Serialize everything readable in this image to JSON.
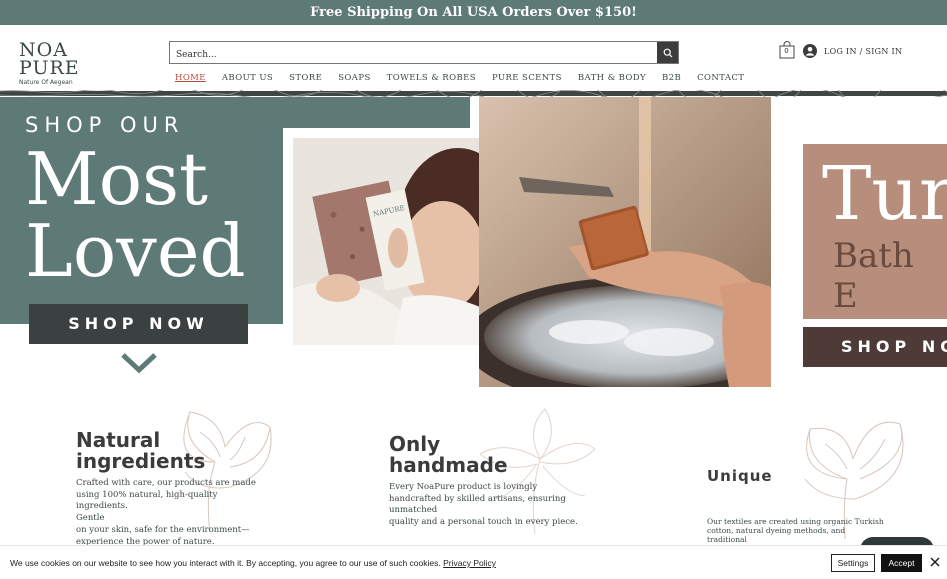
{
  "promo": {
    "text": "Free Shipping On All USA Orders Over $150!"
  },
  "logo": {
    "line1": "NOA",
    "line2": "PURE",
    "tagline": "Nature Of Aegean"
  },
  "search": {
    "placeholder": "Search..."
  },
  "cart": {
    "count": "0"
  },
  "account": {
    "label": "LOG IN / SIGN IN"
  },
  "nav": {
    "items": [
      {
        "label": "HOME"
      },
      {
        "label": "ABOUT US"
      },
      {
        "label": "STORE"
      },
      {
        "label": "SOAPS"
      },
      {
        "label": "TOWELS & ROBES"
      },
      {
        "label": "PURE SCENTS"
      },
      {
        "label": "BATH & BODY"
      },
      {
        "label": "B2B"
      },
      {
        "label": "CONTACT"
      }
    ],
    "active": "HOME"
  },
  "hero": {
    "kicker": "SHOP OUR",
    "headline_1": "Most",
    "headline_2": "Loved",
    "cta": "SHOP NOW",
    "photo1_wrapper_text": "NAPURE"
  },
  "next_slide": {
    "title": "Tur",
    "subtitle": "Bath E",
    "cta": "SHOP NO"
  },
  "features": [
    {
      "title_1": "Natural",
      "title_2": "ingredients",
      "text_1": "Crafted with care, our products are made",
      "text_2": "using 100% natural, high-quality ingredients.",
      "text_3": "Gentle",
      "text_4": "on your skin, safe for the environment—",
      "text_5": "experience the power of nature."
    },
    {
      "title_1": "Only",
      "title_2": "handmade",
      "text_1": "Every NoaPure product is lovingly",
      "text_2": "handcrafted by skilled artisans, ensuring",
      "text_3": "unmatched",
      "text_4": "quality and a personal touch in every piece."
    },
    {
      "title_1": "Unique",
      "text_1": "Our textiles are created using organic Turkish",
      "text_2": "cotton, natural dyeing methods, and",
      "text_3": "traditional"
    }
  ],
  "cookie": {
    "text": "We use cookies on our website to see how you interact with it. By accepting, you agree to our use of such cookies.",
    "link": "Privacy Policy",
    "settings": "Settings",
    "accept": "Accept"
  },
  "colors": {
    "sage": "#5e7a76",
    "charcoal": "#3b4040",
    "accent_nav": "#b5493a",
    "terracotta": "#b78d7c",
    "brown_button": "#4e3a36"
  },
  "icons": [
    "search-icon",
    "cart-icon",
    "user-icon",
    "chevron-down-icon",
    "close-icon",
    "chat-icon"
  ]
}
